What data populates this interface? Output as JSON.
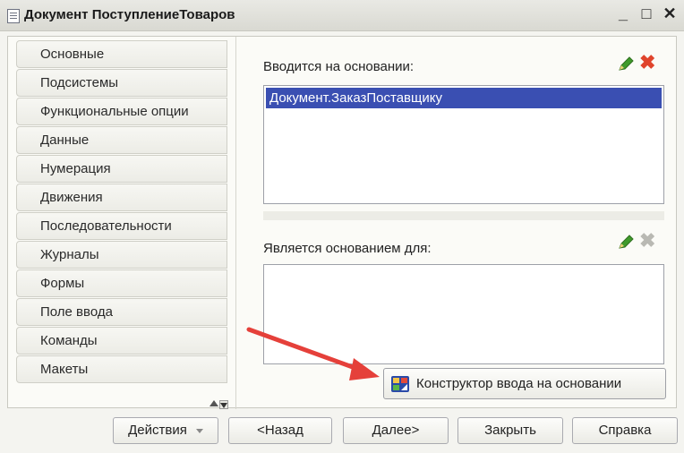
{
  "window": {
    "title": "Документ ПоступлениеТоваров",
    "minimize": "_",
    "maximize": "□",
    "close": "✕"
  },
  "sidebar": {
    "items": [
      "Основные",
      "Подсистемы",
      "Функциональные опции",
      "Данные",
      "Нумерация",
      "Движения",
      "Последовательности",
      "Журналы",
      "Формы",
      "Поле ввода",
      "Команды",
      "Макеты"
    ]
  },
  "main": {
    "entered_on_basis_label": "Вводится на основании:",
    "entered_on_basis_items": [
      "Документ.ЗаказПоставщику"
    ],
    "is_basis_for_label": "Является основанием для:",
    "constructor_button": "Конструктор ввода на основании"
  },
  "footer": {
    "actions": "Действия",
    "back": "<Назад",
    "next": "Далее>",
    "close": "Закрыть",
    "help": "Справка"
  },
  "colors": {
    "selection": "#3a4fb2",
    "delete_active": "#e0442c",
    "delete_disabled": "#b9b9b3",
    "edit_pencil": "#3f9a2b",
    "annotation_arrow": "#e5403a"
  },
  "icons": [
    "document-icon",
    "pencil-icon",
    "delete-icon",
    "constructor-icon",
    "chevron-down-icon",
    "scroll-up-icon",
    "scroll-down-icon"
  ]
}
